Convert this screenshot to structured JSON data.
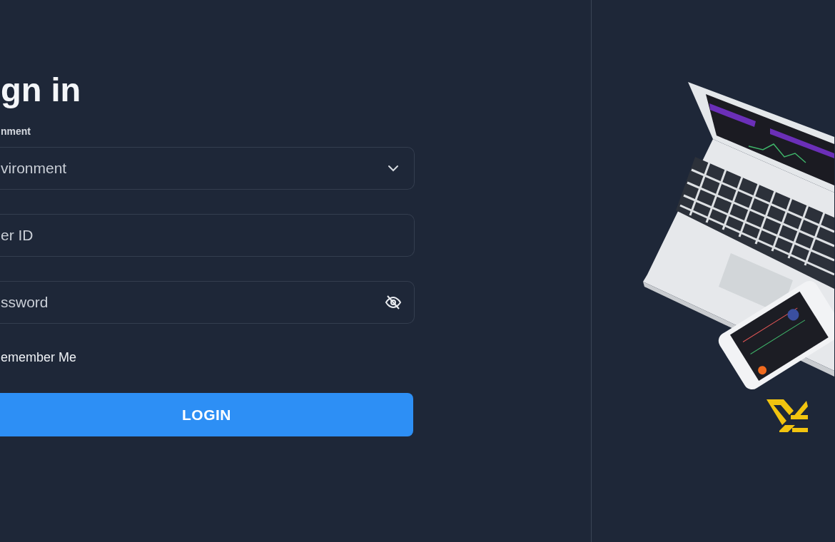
{
  "heading": "gn in",
  "environment": {
    "label": "nment",
    "placeholder": "vironment"
  },
  "user_id": {
    "placeholder": "er ID"
  },
  "password": {
    "placeholder": "ssword"
  },
  "remember": {
    "label": "emember Me"
  },
  "login_button": "LOGIN"
}
